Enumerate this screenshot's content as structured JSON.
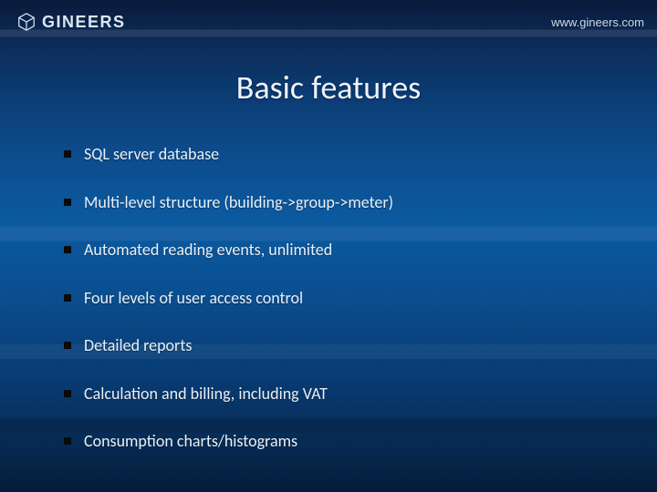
{
  "header": {
    "brand": "GINEERS",
    "url": "www.gineers.com"
  },
  "title": "Basic features",
  "bullets": [
    "SQL server database",
    "Multi-level structure (building->group->meter)",
    "Automated reading events, unlimited",
    "Four levels of user access control",
    "Detailed reports",
    "Calculation and billing, including VAT",
    "Consumption charts/histograms"
  ]
}
